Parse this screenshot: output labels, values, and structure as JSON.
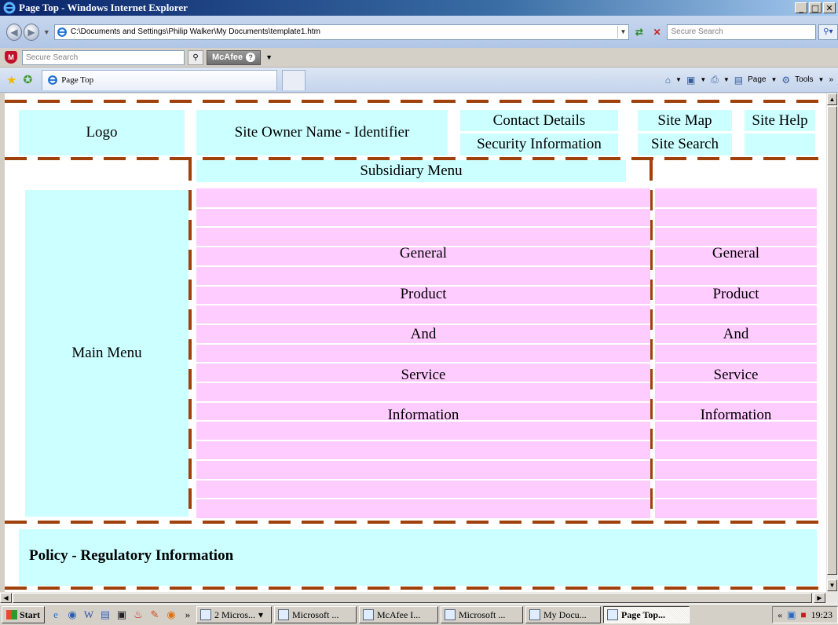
{
  "window": {
    "title": "Page Top - Windows Internet Explorer",
    "minimize": "_",
    "maximize": "□",
    "close": "✕"
  },
  "address_bar": {
    "url": "C:\\Documents and Settings\\Philip Walker\\My Documents\\template1.htm",
    "search_placeholder": "Secure Search"
  },
  "mcafee_bar": {
    "search_placeholder": "Secure Search",
    "logo_text": "McAfee",
    "help": "?"
  },
  "tab_bar": {
    "tab_title": "Page Top",
    "commands": {
      "page": "Page",
      "tools": "Tools"
    }
  },
  "page": {
    "header": {
      "logo": "Logo",
      "site_owner": "Site Owner Name - Identifier",
      "contact": "Contact Details",
      "security": "Security Information",
      "site_map": "Site Map",
      "site_search": "Site Search",
      "site_help": "Site Help"
    },
    "subsidiary_menu": "Subsidiary Menu",
    "main_menu": "Main Menu",
    "content_lines": [
      "General",
      "Product",
      "And",
      "Service",
      "Information"
    ],
    "side_lines": [
      "General",
      "Product",
      "And",
      "Service",
      "Information"
    ],
    "footer": "Policy - Regulatory Information"
  },
  "taskbar": {
    "start": "Start",
    "items": [
      {
        "label": "2 Micros...",
        "active": false
      },
      {
        "label": "Microsoft ...",
        "active": false
      },
      {
        "label": "McAfee I...",
        "active": false
      },
      {
        "label": "Microsoft ...",
        "active": false
      },
      {
        "label": "My Docu...",
        "active": false
      },
      {
        "label": "Page Top...",
        "active": true
      }
    ],
    "clock": "19:23"
  },
  "colors": {
    "cyan_panel": "#ccffff",
    "pink_panel": "#ffccff",
    "dash_border": "#a0400a"
  }
}
